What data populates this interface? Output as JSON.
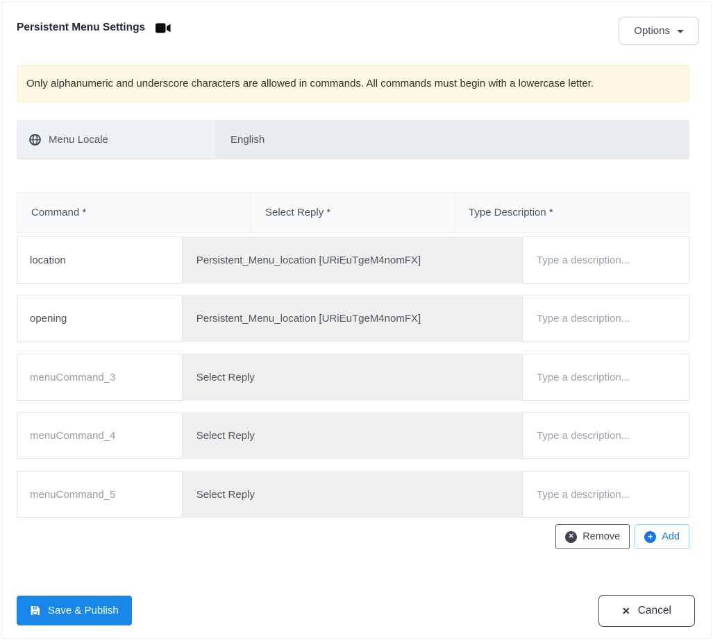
{
  "header": {
    "title": "Persistent Menu Settings",
    "options_label": "Options"
  },
  "alert": {
    "text": "Only alphanumeric and underscore characters are allowed in commands. All commands must begin with a lowercase letter."
  },
  "locale": {
    "label": "Menu Locale",
    "value": "English"
  },
  "table": {
    "headers": [
      "Command *",
      "Select Reply *",
      "Type Description *"
    ],
    "rows": [
      {
        "command_value": "location",
        "reply": "Persistent_Menu_location [URiEuTgeM4nomFX]",
        "description_placeholder": "Type a description..."
      },
      {
        "command_value": "opening",
        "reply": "Persistent_Menu_location [URiEuTgeM4nomFX]",
        "description_placeholder": "Type a description..."
      },
      {
        "command_placeholder": "menuCommand_3",
        "reply": "Select Reply",
        "description_placeholder": "Type a description..."
      },
      {
        "command_placeholder": "menuCommand_4",
        "reply": "Select Reply",
        "description_placeholder": "Type a description..."
      },
      {
        "command_placeholder": "menuCommand_5",
        "reply": "Select Reply",
        "description_placeholder": "Type a description..."
      }
    ]
  },
  "actions": {
    "remove_label": "Remove",
    "add_label": "Add",
    "remove_icon_glyph": "✕",
    "add_icon_glyph": "+"
  },
  "footer": {
    "save_label": "Save & Publish",
    "cancel_label": "Cancel",
    "cancel_icon_glyph": "✕"
  },
  "icons": {
    "title_icon": "video-camera-icon",
    "locale_icon": "globe-icon",
    "options_icon": "caret-down-icon",
    "remove_icon": "circle-x-icon",
    "add_icon": "circle-plus-icon",
    "save_icon": "floppy-disk-icon",
    "cancel_icon": "x-icon"
  },
  "colors": {
    "primary_blue": "#1787e9",
    "add_blue": "#1879e2",
    "alert_background": "#fcf8e4",
    "reply_cell_background": "#efefef",
    "disabled_field_background": "#e9ecef",
    "addon_background": "#edf1f5",
    "table_header_background": "#f8fafb",
    "dark_text": "#21293a"
  }
}
